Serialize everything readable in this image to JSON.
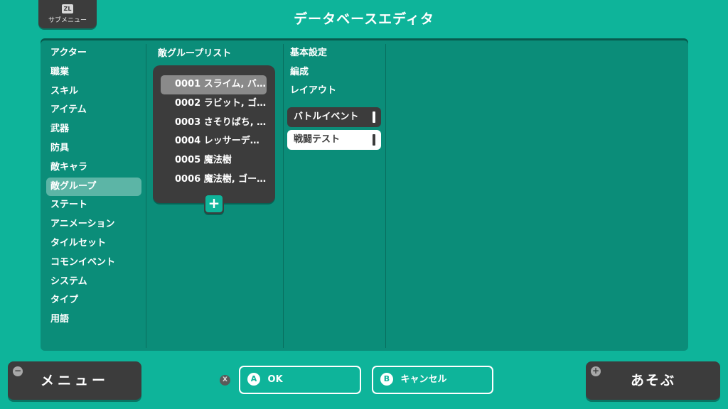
{
  "header": {
    "submenu_icon": "ZL",
    "submenu_label": "サブメニュー",
    "title": "データベースエディタ"
  },
  "categories": [
    {
      "label": "アクター"
    },
    {
      "label": "職業"
    },
    {
      "label": "スキル"
    },
    {
      "label": "アイテム"
    },
    {
      "label": "武器"
    },
    {
      "label": "防具"
    },
    {
      "label": "敵キャラ"
    },
    {
      "label": "敵グループ",
      "selected": true
    },
    {
      "label": "ステート"
    },
    {
      "label": "アニメーション"
    },
    {
      "label": "タイルセット"
    },
    {
      "label": "コモンイベント"
    },
    {
      "label": "システム"
    },
    {
      "label": "タイプ"
    },
    {
      "label": "用語"
    }
  ],
  "group_list": {
    "heading": "敵グループリスト",
    "items": [
      {
        "label": "0001 スライム, バ…",
        "selected": true
      },
      {
        "label": "0002 ラビット, ゴ…"
      },
      {
        "label": "0003 さそりばち, …"
      },
      {
        "label": "0004 レッサーデ…"
      },
      {
        "label": "0005 魔法樹"
      },
      {
        "label": "0006 魔法樹, ゴー…"
      }
    ],
    "add_label": "+"
  },
  "settings": {
    "items": [
      "基本設定",
      "編成",
      "レイアウト"
    ],
    "battle_event": "バトルイベント",
    "battle_test": "戦闘テスト"
  },
  "footer": {
    "menu_label": "メニュー",
    "menu_icon": "−",
    "x_key": "X",
    "ok_key": "A",
    "ok_label": "OK",
    "cancel_key": "B",
    "cancel_label": "キャンセル",
    "play_label": "あそぶ",
    "play_icon": "+"
  },
  "colors": {
    "background": "#0eb49a",
    "panel": "#0b8d79",
    "dark": "#3c3c3c",
    "highlight": "#5cb5a6"
  }
}
